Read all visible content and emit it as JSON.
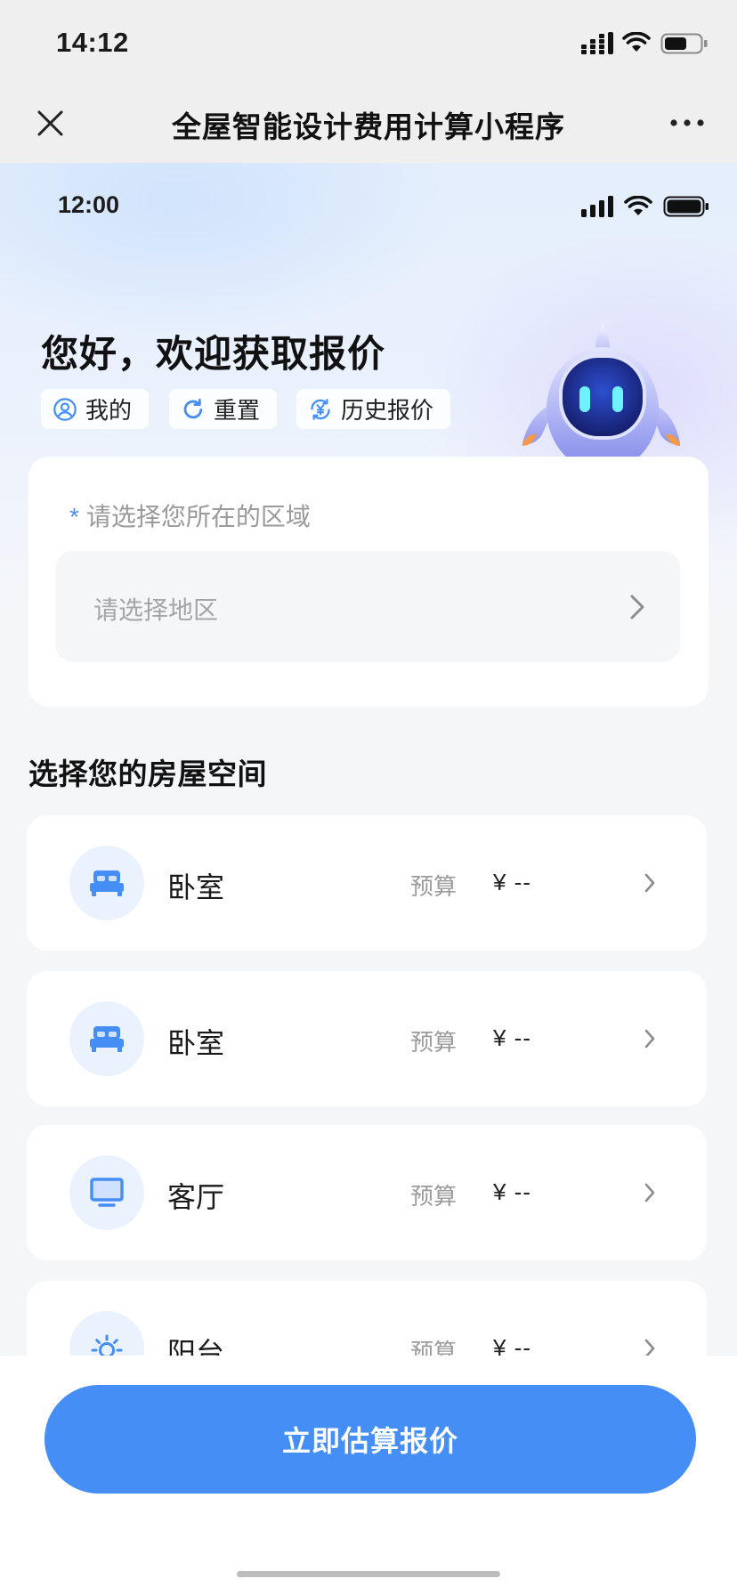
{
  "wechat_status": {
    "time": "14:12"
  },
  "wechat_nav": {
    "title": "全屋智能设计费用计算小程序",
    "close_icon": "close-icon",
    "more_icon": "more-icon"
  },
  "app_status": {
    "time": "12:00"
  },
  "header": {
    "greeting": "您好，欢迎获取报价",
    "chips": [
      {
        "label": "我的",
        "icon": "user-icon"
      },
      {
        "label": "重置",
        "icon": "refresh-icon"
      },
      {
        "label": "历史报价",
        "icon": "price-history-icon"
      }
    ]
  },
  "region": {
    "required_mark": "*",
    "label": "请选择您所在的区域",
    "placeholder": "请选择地区",
    "value": ""
  },
  "spaces": {
    "title": "选择您的房屋空间",
    "rooms": [
      {
        "name": "卧室",
        "icon": "bed-icon",
        "budget_label": "预算",
        "budget_value": "¥ --"
      },
      {
        "name": "卧室",
        "icon": "bed-icon",
        "budget_label": "预算",
        "budget_value": "¥ --"
      },
      {
        "name": "客厅",
        "icon": "tv-icon",
        "budget_label": "预算",
        "budget_value": "¥ --"
      },
      {
        "name": "阳台",
        "icon": "sun-icon",
        "budget_label": "预算",
        "budget_value": "¥ --"
      }
    ]
  },
  "submit": {
    "label": "立即估算报价"
  },
  "colors": {
    "accent": "#448ef6",
    "icon_bg": "#eaf2fd",
    "page_bg": "#f5f6f8",
    "nav_bg": "#efefef"
  }
}
